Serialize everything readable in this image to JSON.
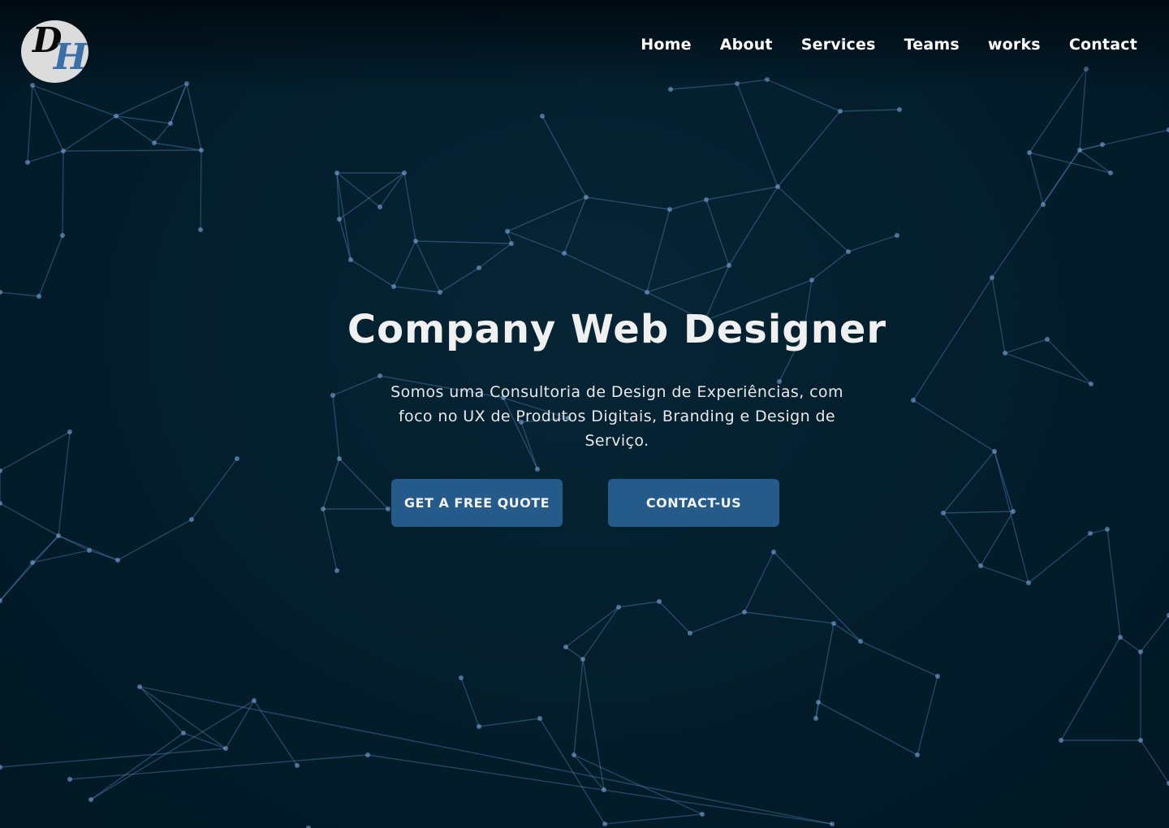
{
  "logo": {
    "letter_d": "D",
    "letter_h": "H"
  },
  "nav": {
    "items": [
      "Home",
      "About",
      "Services",
      "Teams",
      "works",
      "Contact"
    ]
  },
  "hero": {
    "title": "Company Web Designer",
    "subtitle": "Somos  uma Consultoria de Design de Experiências, com foco no UX de Produtos Digitais, Branding e Design de Serviço.",
    "quote_button": "GET A FREE QUOTE",
    "contact_button": "CONTACT-US"
  },
  "colors": {
    "background": "#021b29",
    "button": "#245b8a",
    "network_lines": "#5d8fc4",
    "logo_h": "#3a6fa8"
  }
}
